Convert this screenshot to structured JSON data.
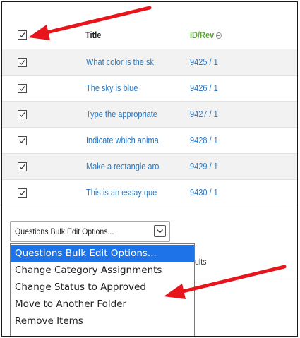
{
  "table": {
    "header": {
      "title": "Title",
      "id_rev": "ID/Rev"
    },
    "rows": [
      {
        "title": "What color is the sk",
        "id_rev": "9425 / 1"
      },
      {
        "title": "The sky is blue",
        "id_rev": "9426 / 1"
      },
      {
        "title": "Type the appropriate",
        "id_rev": "9427 / 1"
      },
      {
        "title": "Indicate which anima",
        "id_rev": "9428 / 1"
      },
      {
        "title": "Make a rectangle aro",
        "id_rev": "9429 / 1"
      },
      {
        "title": "This is an essay que",
        "id_rev": "9430 / 1"
      }
    ]
  },
  "bulk_edit": {
    "selected": "Questions Bulk Edit Options...",
    "options": [
      "Questions Bulk Edit Options...",
      "Change Category Assignments",
      "Change Status to Approved",
      "Move to Another Folder",
      "Remove Items"
    ]
  },
  "results_fragment": "ults",
  "colors": {
    "link": "#2b78c2",
    "id_header": "#5aa53a",
    "selected_option": "#1e73e8",
    "annotation_arrow": "#e8141b"
  },
  "icons": {
    "checkbox": "checkmark-icon",
    "sort": "sort-icon",
    "dropdown": "chevron-down-icon",
    "annotation": "red-arrow-icon"
  }
}
